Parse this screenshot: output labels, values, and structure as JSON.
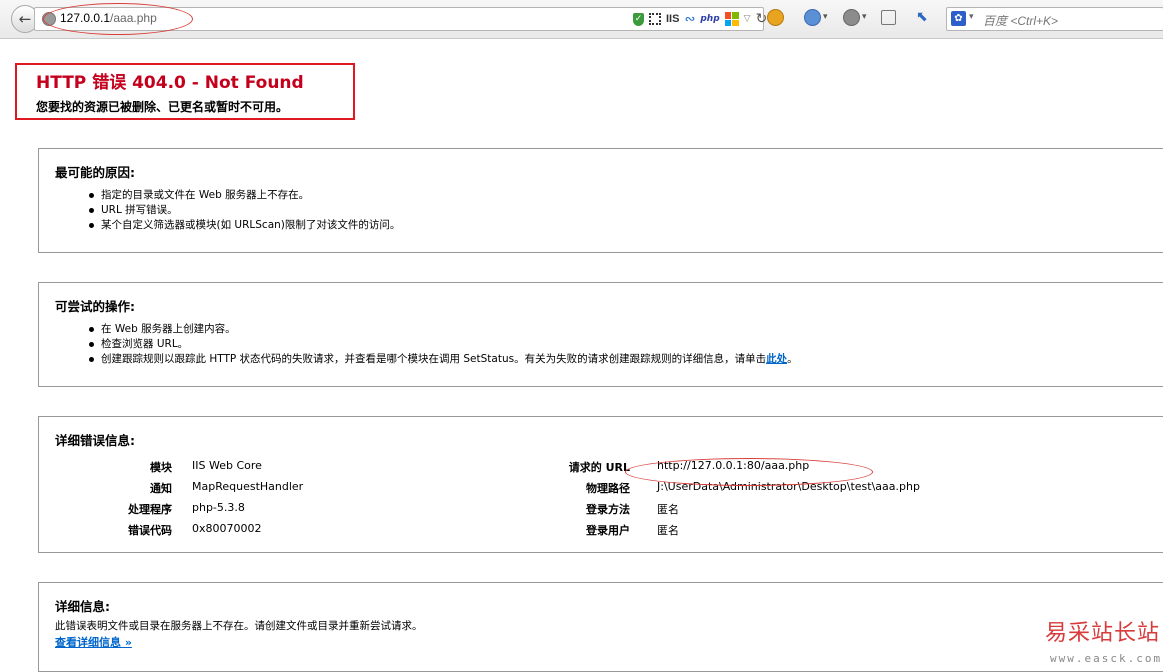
{
  "browser": {
    "url_host": "127.0.0.1",
    "url_path": "/aaa.php",
    "addon_iis_label": "IIS",
    "addon_php_label": "php",
    "search_placeholder": "百度 <Ctrl+K>"
  },
  "error": {
    "title": "HTTP 错误 404.0 - Not Found",
    "subtitle": "您要找的资源已被删除、已更名或暂时不可用。"
  },
  "causes": {
    "heading": "最可能的原因:",
    "items": [
      "指定的目录或文件在 Web 服务器上不存在。",
      "URL 拼写错误。",
      "某个自定义筛选器或模块(如 URLScan)限制了对该文件的访问。"
    ]
  },
  "actions": {
    "heading": "可尝试的操作:",
    "items": [
      "在 Web 服务器上创建内容。",
      "检查浏览器 URL。"
    ],
    "item3_text": "创建跟踪规则以跟踪此 HTTP 状态代码的失败请求，并查看是哪个模块在调用 SetStatus。有关为失败的请求创建跟踪规则的详细信息，请单击",
    "item3_link": "此处",
    "item3_end": "。"
  },
  "details": {
    "heading": "详细错误信息:",
    "left": [
      {
        "label": "模块",
        "value": "IIS Web Core"
      },
      {
        "label": "通知",
        "value": "MapRequestHandler"
      },
      {
        "label": "处理程序",
        "value": "php-5.3.8"
      },
      {
        "label": "错误代码",
        "value": "0x80070002"
      }
    ],
    "right": [
      {
        "label": "请求的 URL",
        "value": "http://127.0.0.1:80/aaa.php"
      },
      {
        "label": "物理路径",
        "value": "J:\\UserData\\Administrator\\Desktop\\test\\aaa.php"
      },
      {
        "label": "登录方法",
        "value": "匿名"
      },
      {
        "label": "登录用户",
        "value": "匿名"
      }
    ]
  },
  "more_info": {
    "heading": "详细信息:",
    "text": "此错误表明文件或目录在服务器上不存在。请创建文件或目录并重新尝试请求。",
    "link": "查看详细信息 »"
  },
  "watermark": {
    "cn": "易采站长站",
    "en": "www.easck.com"
  }
}
